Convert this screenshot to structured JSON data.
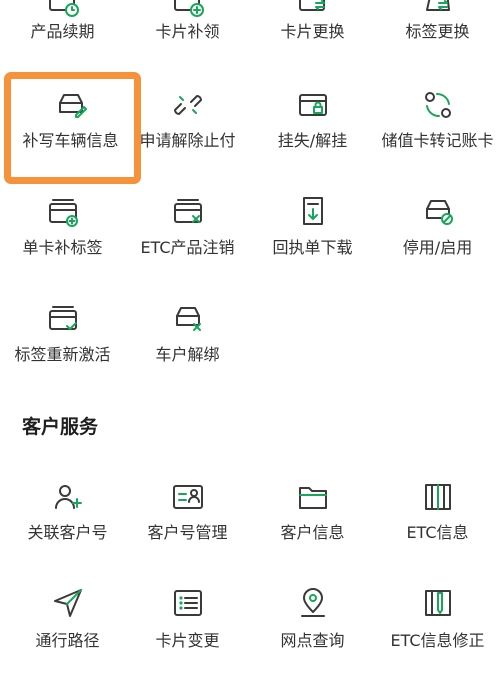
{
  "accent_color": "#17a75a",
  "highlight_color": "#f5923a",
  "top_rows": [
    [
      {
        "label": "产品续期",
        "icon": "card-clock-icon"
      },
      {
        "label": "卡片补领",
        "icon": "card-add-icon"
      },
      {
        "label": "卡片更换",
        "icon": "card-swap-icon"
      },
      {
        "label": "标签更换",
        "icon": "tag-swap-icon"
      }
    ],
    [
      {
        "label": "补写车辆信息",
        "icon": "car-edit-icon"
      },
      {
        "label": "申请解除止付",
        "icon": "unlink-icon"
      },
      {
        "label": "挂失/解挂",
        "icon": "card-lock-icon"
      },
      {
        "label": "储值卡转记账卡",
        "icon": "card-convert-icon"
      }
    ],
    [
      {
        "label": "单卡补标签",
        "icon": "card-plus-icon"
      },
      {
        "label": "ETC产品注销",
        "icon": "card-cancel-icon"
      },
      {
        "label": "回执单下载",
        "icon": "receipt-download-icon"
      },
      {
        "label": "停用/启用",
        "icon": "car-disable-icon"
      }
    ],
    [
      {
        "label": "标签重新激活",
        "icon": "tag-activate-icon"
      },
      {
        "label": "车户解绑",
        "icon": "car-unbind-icon"
      }
    ]
  ],
  "customer_service": {
    "title": "客户服务",
    "rows": [
      [
        {
          "label": "关联客户号",
          "icon": "user-add-icon"
        },
        {
          "label": "客户号管理",
          "icon": "user-card-icon"
        },
        {
          "label": "客户信息",
          "icon": "folder-icon"
        },
        {
          "label": "ETC信息",
          "icon": "book-icon"
        }
      ],
      [
        {
          "label": "通行路径",
          "icon": "navigation-icon"
        },
        {
          "label": "卡片变更",
          "icon": "list-card-icon"
        },
        {
          "label": "网点查询",
          "icon": "location-pin-icon"
        },
        {
          "label": "ETC信息修正",
          "icon": "book-edit-icon"
        }
      ]
    ]
  }
}
